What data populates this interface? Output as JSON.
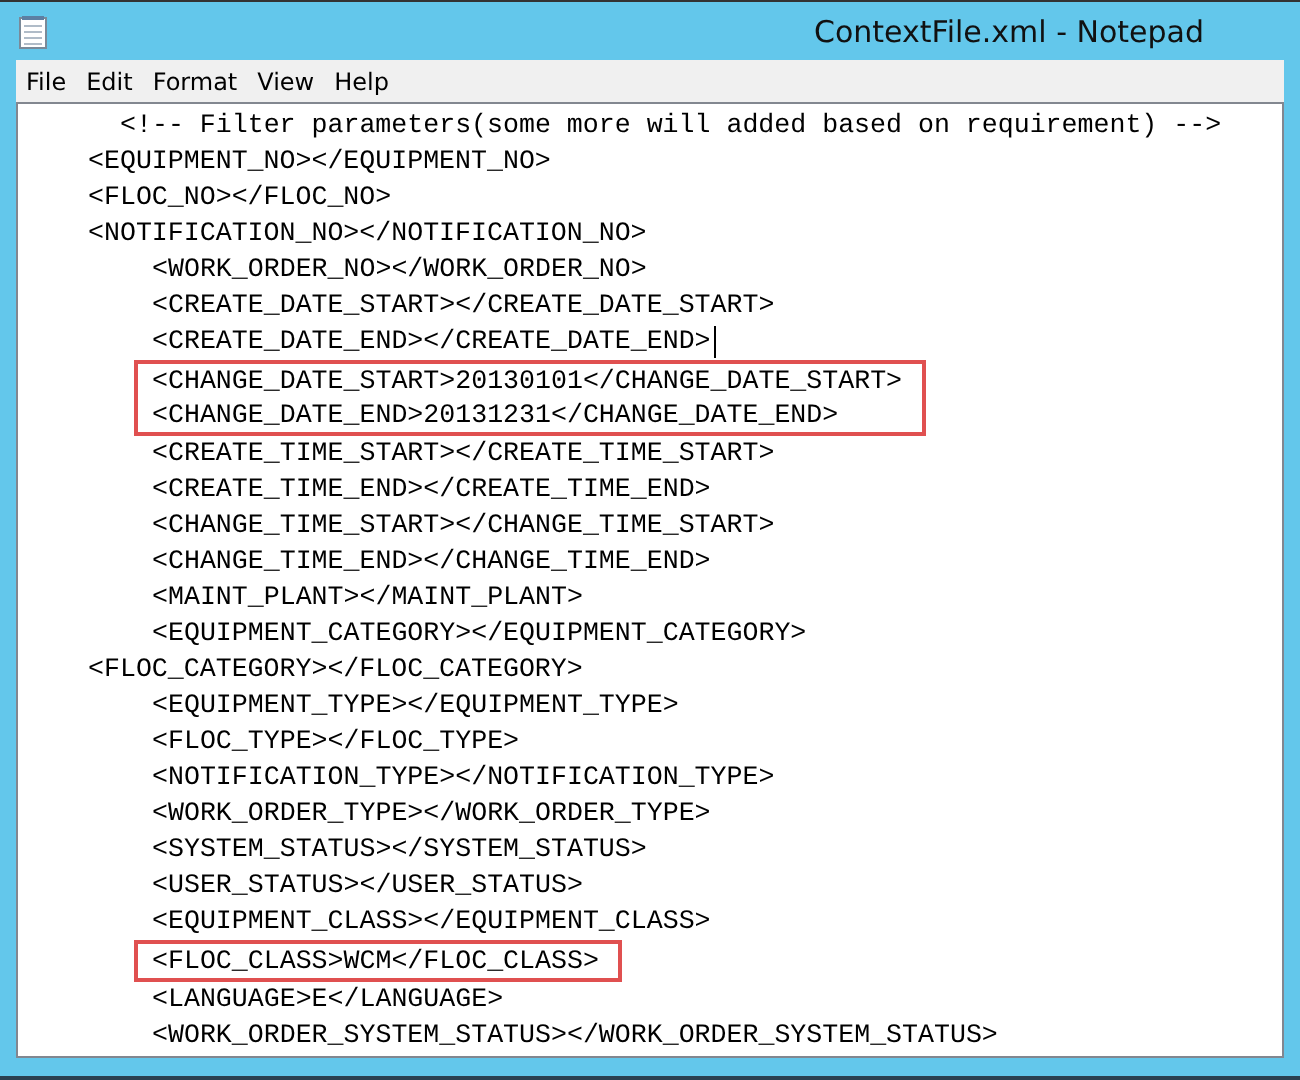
{
  "window": {
    "title": "ContextFile.xml - Notepad"
  },
  "menu": [
    "File",
    "Edit",
    "Format",
    "View",
    "Help"
  ],
  "editor": {
    "lines": [
      {
        "kind": "comment",
        "text": "<!-- Filter parameters(some more will added based on requirement) -->"
      },
      {
        "kind": "element",
        "text": "<EQUIPMENT_NO></EQUIPMENT_NO>"
      },
      {
        "kind": "element",
        "text": "<FLOC_NO></FLOC_NO>"
      },
      {
        "kind": "element",
        "text": "<NOTIFICATION_NO></NOTIFICATION_NO>",
        "children": [
          {
            "text": "<WORK_ORDER_NO></WORK_ORDER_NO>",
            "highlighted": false,
            "caret": false
          },
          {
            "text": "<CREATE_DATE_START></CREATE_DATE_START>",
            "highlighted": false,
            "caret": false
          },
          {
            "text": "<CREATE_DATE_END></CREATE_DATE_END>",
            "highlighted": false,
            "caret": true
          },
          {
            "text": "<CHANGE_DATE_START>20130101</CHANGE_DATE_START>",
            "highlighted": true,
            "caret": false
          },
          {
            "text": "<CHANGE_DATE_END>20131231</CHANGE_DATE_END>",
            "highlighted": true,
            "caret": false
          },
          {
            "text": "<CREATE_TIME_START></CREATE_TIME_START>",
            "highlighted": false,
            "caret": false
          },
          {
            "text": "<CREATE_TIME_END></CREATE_TIME_END>",
            "highlighted": false,
            "caret": false
          },
          {
            "text": "<CHANGE_TIME_START></CHANGE_TIME_START>",
            "highlighted": false,
            "caret": false
          },
          {
            "text": "<CHANGE_TIME_END></CHANGE_TIME_END>",
            "highlighted": false,
            "caret": false
          },
          {
            "text": "<MAINT_PLANT></MAINT_PLANT>",
            "highlighted": false,
            "caret": false
          },
          {
            "text": "<EQUIPMENT_CATEGORY></EQUIPMENT_CATEGORY>",
            "highlighted": false,
            "caret": false
          }
        ]
      },
      {
        "kind": "element",
        "text": "<FLOC_CATEGORY></FLOC_CATEGORY>",
        "children": [
          {
            "text": "<EQUIPMENT_TYPE></EQUIPMENT_TYPE>",
            "highlighted": false,
            "caret": false
          },
          {
            "text": "<FLOC_TYPE></FLOC_TYPE>",
            "highlighted": false,
            "caret": false
          },
          {
            "text": "<NOTIFICATION_TYPE></NOTIFICATION_TYPE>",
            "highlighted": false,
            "caret": false
          },
          {
            "text": "<WORK_ORDER_TYPE></WORK_ORDER_TYPE>",
            "highlighted": false,
            "caret": false
          },
          {
            "text": "<SYSTEM_STATUS></SYSTEM_STATUS>",
            "highlighted": false,
            "caret": false
          },
          {
            "text": "<USER_STATUS></USER_STATUS>",
            "highlighted": false,
            "caret": false
          },
          {
            "text": "<EQUIPMENT_CLASS></EQUIPMENT_CLASS>",
            "highlighted": false,
            "caret": false
          },
          {
            "text": "<FLOC_CLASS>WCM</FLOC_CLASS>",
            "highlighted": true,
            "caret": false
          },
          {
            "text": "<LANGUAGE>E</LANGUAGE>",
            "highlighted": false,
            "caret": false
          },
          {
            "text": "<WORK_ORDER_SYSTEM_STATUS></WORK_ORDER_SYSTEM_STATUS>",
            "highlighted": false,
            "caret": false
          }
        ]
      }
    ]
  }
}
